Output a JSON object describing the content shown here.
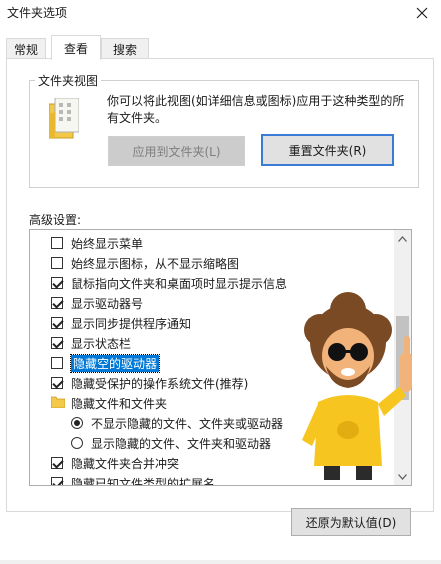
{
  "window": {
    "title": "文件夹选项"
  },
  "tabs": [
    {
      "label": "常规"
    },
    {
      "label": "查看"
    },
    {
      "label": "搜索"
    }
  ],
  "folder_views": {
    "legend": "文件夹视图",
    "description": "你可以将此视图(如详细信息或图标)应用于这种类型的所有文件夹。",
    "apply_button": "应用到文件夹(L)",
    "reset_button": "重置文件夹(R)"
  },
  "advanced": {
    "label": "高级设置:",
    "items": [
      {
        "type": "checkbox",
        "checked": false,
        "label": "始终显示菜单"
      },
      {
        "type": "checkbox",
        "checked": false,
        "label": "始终显示图标，从不显示缩略图"
      },
      {
        "type": "checkbox",
        "checked": true,
        "label": "鼠标指向文件夹和桌面项时显示提示信息"
      },
      {
        "type": "checkbox",
        "checked": true,
        "label": "显示驱动器号"
      },
      {
        "type": "checkbox",
        "checked": true,
        "label": "显示同步提供程序通知"
      },
      {
        "type": "checkbox",
        "checked": true,
        "label": "显示状态栏"
      },
      {
        "type": "checkbox",
        "checked": false,
        "label": "隐藏空的驱动器",
        "selected": true
      },
      {
        "type": "checkbox",
        "checked": true,
        "label": "隐藏受保护的操作系统文件(推荐)"
      },
      {
        "type": "folder",
        "label": "隐藏文件和文件夹"
      },
      {
        "type": "radio",
        "checked": true,
        "label": "不显示隐藏的文件、文件夹或驱动器"
      },
      {
        "type": "radio",
        "checked": false,
        "label": "显示隐藏的文件、文件夹和驱动器"
      },
      {
        "type": "checkbox",
        "checked": true,
        "label": "隐藏文件夹合并冲突"
      },
      {
        "type": "checkbox",
        "checked": true,
        "label": "隐藏已知文件类型的扩展名"
      }
    ]
  },
  "restore_button": "还原为默认值(D)"
}
